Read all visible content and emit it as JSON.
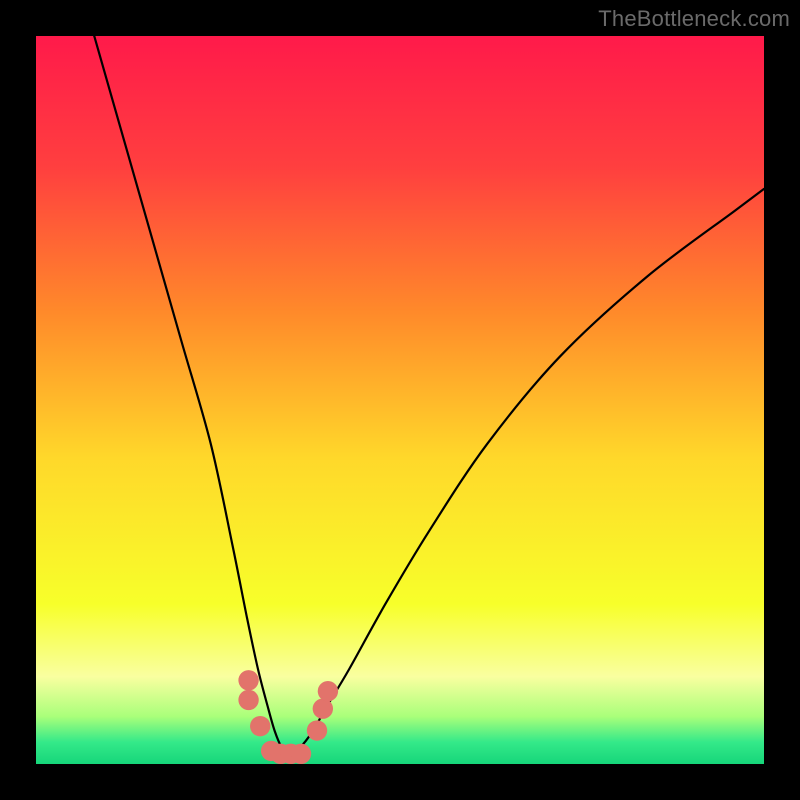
{
  "watermark": "TheBottleneck.com",
  "chart_data": {
    "type": "line",
    "title": "",
    "xlabel": "",
    "ylabel": "",
    "xlim": [
      0,
      100
    ],
    "ylim": [
      0,
      100
    ],
    "grid": false,
    "legend": false,
    "gradient_stops": [
      {
        "offset": 0,
        "color": "#ff1a4a"
      },
      {
        "offset": 0.18,
        "color": "#ff3f3f"
      },
      {
        "offset": 0.38,
        "color": "#ff8a2a"
      },
      {
        "offset": 0.58,
        "color": "#ffd82a"
      },
      {
        "offset": 0.78,
        "color": "#f7ff2a"
      },
      {
        "offset": 0.88,
        "color": "#f9ffa0"
      },
      {
        "offset": 0.935,
        "color": "#a9ff7a"
      },
      {
        "offset": 0.97,
        "color": "#34e989"
      },
      {
        "offset": 1.0,
        "color": "#16d67a"
      }
    ],
    "series": [
      {
        "name": "bottleneck-curve",
        "color": "#000000",
        "x": [
          8,
          12,
          16,
          20,
          24,
          27,
          29,
          30.5,
          31.8,
          32.8,
          33.8,
          34.8,
          36.2,
          38,
          40,
          43,
          48,
          54,
          62,
          72,
          84,
          96,
          100
        ],
        "y": [
          100,
          86,
          72,
          58,
          44,
          30,
          20,
          13,
          8,
          4.5,
          2.2,
          1.4,
          2.2,
          4.5,
          8,
          13,
          22,
          32,
          44,
          56,
          67,
          76,
          79
        ]
      }
    ],
    "markers": {
      "name": "bottom-markers",
      "color": "#e2736b",
      "radius_pct": 1.4,
      "points": [
        {
          "x": 29.2,
          "y": 11.5
        },
        {
          "x": 29.2,
          "y": 8.8
        },
        {
          "x": 30.8,
          "y": 5.2
        },
        {
          "x": 32.3,
          "y": 1.8
        },
        {
          "x": 33.6,
          "y": 1.4
        },
        {
          "x": 35.0,
          "y": 1.4
        },
        {
          "x": 36.4,
          "y": 1.4
        },
        {
          "x": 38.6,
          "y": 4.6
        },
        {
          "x": 39.4,
          "y": 7.6
        },
        {
          "x": 40.1,
          "y": 10.0
        }
      ]
    }
  }
}
